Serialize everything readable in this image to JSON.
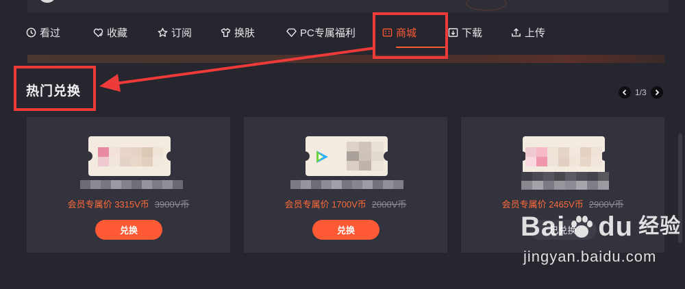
{
  "nav": {
    "items": [
      {
        "label": "看过",
        "icon": "clock-icon"
      },
      {
        "label": "收藏",
        "icon": "heart-icon"
      },
      {
        "label": "订阅",
        "icon": "star-icon"
      },
      {
        "label": "换肤",
        "icon": "shirt-icon"
      },
      {
        "label": "PC专属福利",
        "icon": "diamond-icon"
      },
      {
        "label": "商城",
        "icon": "store-icon",
        "active": true
      },
      {
        "label": "下载",
        "icon": "download-icon"
      },
      {
        "label": "上传",
        "icon": "upload-icon"
      }
    ]
  },
  "section": {
    "title": "热门兑换",
    "pager": "1/3"
  },
  "cards": [
    {
      "member_price": "会员专属价 3315V币",
      "original_price": "3900V币",
      "button": "兑换",
      "redeemed": false
    },
    {
      "member_price": "会员专属价 1700V币",
      "original_price": "2000V币",
      "button": "兑换",
      "redeemed": false
    },
    {
      "member_price": "会员专属价 2465V币",
      "original_price": "2900V币",
      "button": "已兑换",
      "redeemed": true
    }
  ],
  "watermark": {
    "brand_a": "Bai",
    "brand_b": "du",
    "brand_cn": "经验",
    "url": "jingyan.baidu.com"
  },
  "colors": {
    "background": "#26262e",
    "card": "#33333d",
    "accent": "#ff5a36",
    "annotation": "#ef3a3a"
  }
}
